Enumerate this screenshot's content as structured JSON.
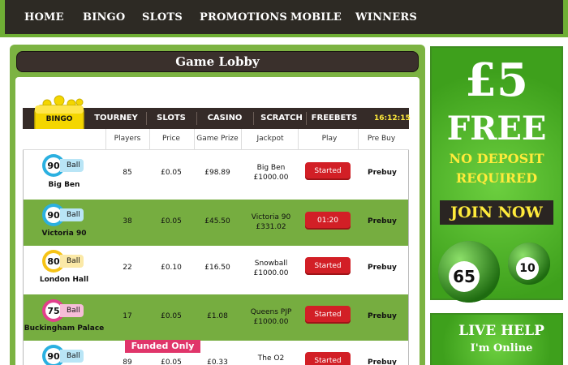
{
  "nav": {
    "items": [
      "HOME",
      "BINGO",
      "SLOTS",
      "PROMOTIONS",
      "MOBILE",
      "WINNERS"
    ]
  },
  "lobby": {
    "title": "Game Lobby",
    "tabs": [
      "BINGO",
      "TOURNEY",
      "SLOTS",
      "CASINO",
      "SCRATCH",
      "FREEBETS"
    ],
    "clock": "16:12:15",
    "columns": [
      "Players",
      "Price",
      "Game Prize",
      "Jackpot",
      "Play",
      "Pre Buy"
    ],
    "funded_label": "Funded Only",
    "rows": [
      {
        "ball_number": "90",
        "ball_label": "Ball",
        "ball_color": "#2bb0e0",
        "name": "Big Ben",
        "players": "85",
        "price": "£0.05",
        "prize": "£98.89",
        "jackpot_name": "Big Ben",
        "jackpot_value": "£1000.00",
        "play": "Started",
        "prebuy": "Prebuy"
      },
      {
        "ball_number": "90",
        "ball_label": "Ball",
        "ball_color": "#2bb0e0",
        "name": "Victoria 90",
        "players": "38",
        "price": "£0.05",
        "prize": "£45.50",
        "jackpot_name": "Victoria 90",
        "jackpot_value": "£331.02",
        "play": "01:20",
        "prebuy": "Prebuy"
      },
      {
        "ball_number": "80",
        "ball_label": "Ball",
        "ball_color": "#f6c316",
        "name": "London Hall",
        "players": "22",
        "price": "£0.10",
        "prize": "£16.50",
        "jackpot_name": "Snowball",
        "jackpot_value": "£1000.00",
        "play": "Started",
        "prebuy": "Prebuy"
      },
      {
        "ball_number": "75",
        "ball_label": "Ball",
        "ball_color": "#e2408c",
        "name": "Buckingham Palace",
        "players": "17",
        "price": "£0.05",
        "prize": "£1.08",
        "jackpot_name": "Queens PJP",
        "jackpot_value": "£1000.00",
        "play": "Started",
        "prebuy": "Prebuy"
      },
      {
        "ball_number": "90",
        "ball_label": "Ball",
        "ball_color": "#2bb0e0",
        "name": "",
        "players": "89",
        "price": "£0.05",
        "prize": "£0.33",
        "jackpot_name": "The O2",
        "jackpot_value": "",
        "play": "Started",
        "prebuy": "Prebuy"
      }
    ]
  },
  "promo": {
    "amount": "£5",
    "free": "FREE",
    "line1": "NO DEPOSIT",
    "line2": "REQUIRED",
    "join": "JOIN NOW",
    "ball1": "65",
    "ball2": "10"
  },
  "help": {
    "title": "LIVE HELP",
    "subtitle": "I'm Online"
  },
  "colors": {
    "brand_green": "#7cb342",
    "dark": "#2d2a24",
    "red": "#d21f26",
    "pink": "#e0356a",
    "yellow": "#ffeb3b"
  }
}
